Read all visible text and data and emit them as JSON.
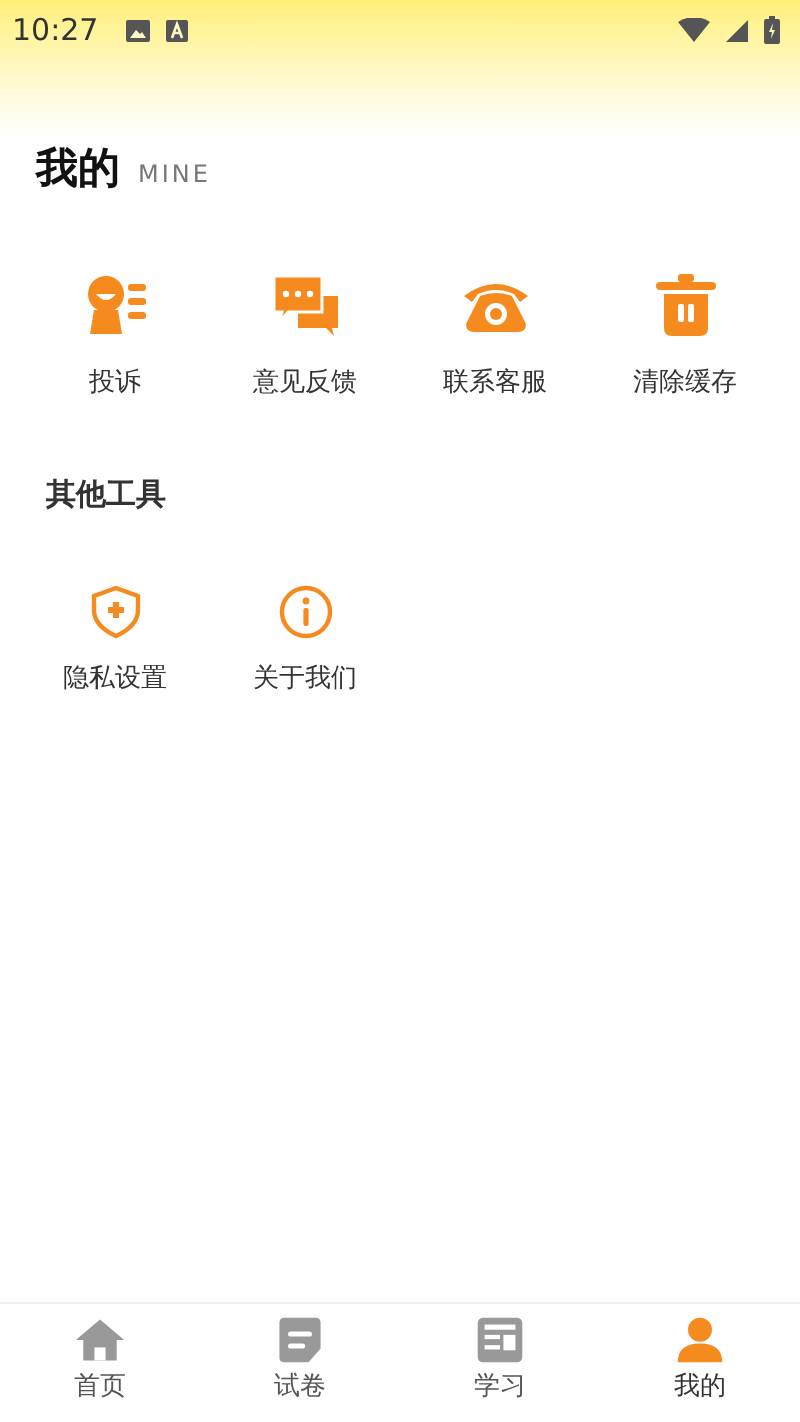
{
  "status_bar": {
    "time": "10:27"
  },
  "header": {
    "title": "我的",
    "subtitle": "MINE"
  },
  "main_tools": [
    {
      "kind": "complaint",
      "label": "投诉"
    },
    {
      "kind": "feedback",
      "label": "意见反馈"
    },
    {
      "kind": "phone",
      "label": "联系客服"
    },
    {
      "kind": "trash",
      "label": "清除缓存"
    }
  ],
  "other_tools": {
    "title": "其他工具",
    "items": [
      {
        "kind": "shield",
        "label": "隐私设置"
      },
      {
        "kind": "info",
        "label": "关于我们"
      }
    ]
  },
  "bottom_nav": [
    {
      "kind": "home",
      "label": "首页",
      "selected": false
    },
    {
      "kind": "paper",
      "label": "试卷",
      "selected": false
    },
    {
      "kind": "study",
      "label": "学习",
      "selected": false
    },
    {
      "kind": "person",
      "label": "我的",
      "selected": true
    }
  ]
}
